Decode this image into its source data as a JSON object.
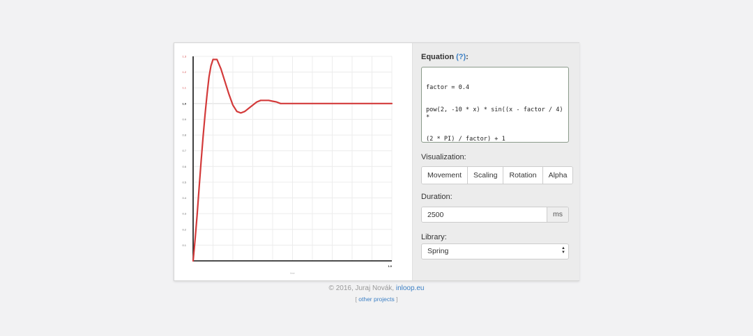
{
  "chart_data": {
    "type": "line",
    "y_ticks": [
      "0.1",
      "0.2",
      "0.3",
      "0.4",
      "0.5",
      "0.6",
      "0.7",
      "0.8",
      "0.9",
      "1.0",
      "1.1",
      "1.2",
      "1.3"
    ],
    "x_tick_end": "1.0",
    "x_caption": "time",
    "xlim": [
      0,
      1
    ],
    "ylim": [
      0,
      1.3
    ],
    "grid": true,
    "series": [
      {
        "color": "#d33a3a",
        "x": [
          0,
          0.01,
          0.02,
          0.03,
          0.04,
          0.05,
          0.06,
          0.07,
          0.08,
          0.09,
          0.1,
          0.12,
          0.14,
          0.16,
          0.18,
          0.2,
          0.22,
          0.24,
          0.26,
          0.28,
          0.3,
          0.32,
          0.34,
          0.36,
          0.38,
          0.4,
          0.42,
          0.44,
          0.46,
          0.48,
          0.5,
          0.55,
          0.6,
          0.65,
          0.7,
          0.75,
          0.8,
          0.85,
          0.9,
          0.95,
          1.0
        ],
        "y": [
          0,
          0.14,
          0.29,
          0.46,
          0.63,
          0.79,
          0.93,
          1.06,
          1.17,
          1.24,
          1.28,
          1.28,
          1.22,
          1.14,
          1.06,
          0.99,
          0.95,
          0.94,
          0.95,
          0.97,
          0.99,
          1.01,
          1.02,
          1.02,
          1.02,
          1.015,
          1.01,
          1.0,
          1.0,
          1.0,
          1.0,
          1.0,
          1.0,
          1.0,
          1.0,
          1.0,
          1.0,
          1.0,
          1.0,
          1.0,
          1.0
        ]
      }
    ]
  },
  "panel": {
    "equation_label": "Equation",
    "help_link": "(?)",
    "equation_suffix": ":",
    "equation_lines": [
      "factor = 0.4",
      "pow(2, -10 * x) * sin((x - factor / 4) *",
      "(2 * PI) / factor) + 1"
    ],
    "visualization_label": "Visualization:",
    "visualization_buttons": [
      "Movement",
      "Scaling",
      "Rotation",
      "Alpha"
    ],
    "duration_label": "Duration:",
    "duration_value": "2500",
    "duration_unit": "ms",
    "library_label": "Library:",
    "library_value": "Spring"
  },
  "footer": {
    "copyright": "© 2016, Juraj Novák,",
    "site_link": "inloop.eu",
    "other_projects_prefix": "[",
    "other_projects": "other projects",
    "other_projects_suffix": "]"
  }
}
